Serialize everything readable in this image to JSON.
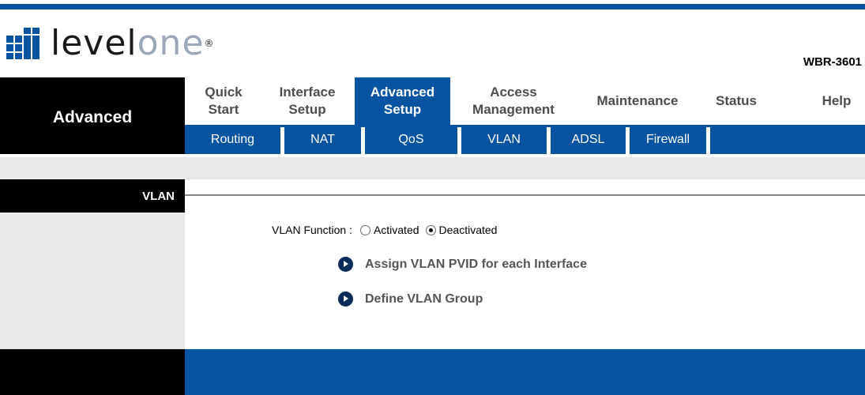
{
  "brand": {
    "logo_text_a": "level",
    "logo_text_b": "one",
    "trademark": "®",
    "model": "WBR-3601"
  },
  "section": {
    "title": "Advanced"
  },
  "main_menu": [
    {
      "line1": "Quick",
      "line2": "Start",
      "active": false
    },
    {
      "line1": "Interface",
      "line2": "Setup",
      "active": false
    },
    {
      "line1": "Advanced",
      "line2": "Setup",
      "active": true
    },
    {
      "line1": "Access",
      "line2": "Management",
      "active": false
    },
    {
      "line1": "Maintenance",
      "line2": "",
      "active": false
    },
    {
      "line1": "Status",
      "line2": "",
      "active": false
    },
    {
      "line1": "Help",
      "line2": "",
      "active": false
    }
  ],
  "sub_menu": [
    "Routing",
    "NAT",
    "QoS",
    "VLAN",
    "ADSL",
    "Firewall"
  ],
  "page": {
    "label": "VLAN",
    "function_label": "VLAN Function :",
    "options": [
      {
        "label": "Activated",
        "checked": false
      },
      {
        "label": "Deactivated",
        "checked": true
      }
    ],
    "links": [
      "Assign VLAN PVID for each Interface",
      "Define VLAN Group"
    ]
  },
  "colors": {
    "accent": "#0653a2",
    "black": "#000000",
    "gray": "#e8e8e8",
    "menu_text": "#4d4d4d"
  }
}
